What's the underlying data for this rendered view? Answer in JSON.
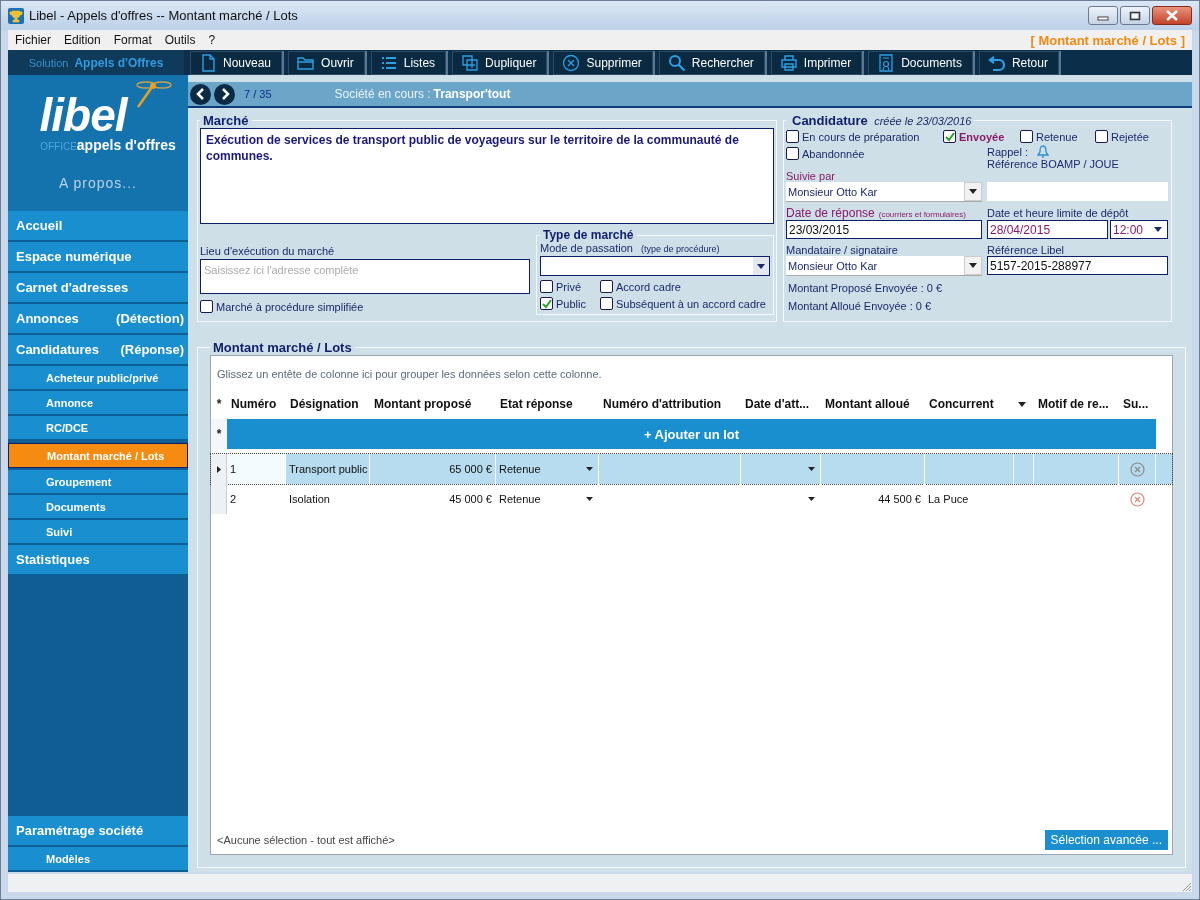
{
  "window": {
    "title": "Libel - Appels d'offres -- Montant marché / Lots",
    "section_tag": "[ Montant marché / Lots ]"
  },
  "menu": [
    "Fichier",
    "Edition",
    "Format",
    "Outils",
    "?"
  ],
  "toolbar": {
    "solution_label": "Solution",
    "solution_name": "Appels d'Offres",
    "buttons": [
      {
        "label": "Nouveau",
        "kind": "new"
      },
      {
        "label": "Ouvrir",
        "kind": "open"
      },
      {
        "label": "Listes",
        "kind": "list"
      },
      {
        "label": "Dupliquer",
        "kind": "duplicate"
      },
      {
        "label": "Supprimer",
        "kind": "delete"
      },
      {
        "label": "Rechercher",
        "kind": "search"
      },
      {
        "label": "Imprimer",
        "kind": "print"
      },
      {
        "label": "Documents",
        "kind": "document"
      },
      {
        "label": "Retour",
        "kind": "back"
      }
    ]
  },
  "sidebar": {
    "brand": "libel",
    "brand_office": "OFFICE",
    "brand_tagline": "appels d'offres",
    "about": "A propos...",
    "items": [
      {
        "label": "Accueil",
        "kind": "main",
        "selected": false
      },
      {
        "label": "Espace numérique",
        "kind": "main",
        "selected": false
      },
      {
        "label": "Carnet d'adresses",
        "kind": "main",
        "selected": false
      },
      {
        "label": "Annonces",
        "note": "(Détection)",
        "kind": "main",
        "selected": false
      },
      {
        "label": "Candidatures",
        "note": "(Réponse)",
        "kind": "main",
        "selected": false
      },
      {
        "label": "Acheteur public/privé",
        "kind": "sub",
        "selected": false
      },
      {
        "label": "Annonce",
        "kind": "sub",
        "selected": false
      },
      {
        "label": "RC/DCE",
        "kind": "sub",
        "selected": false
      },
      {
        "label": "Montant marché / Lots",
        "kind": "sub",
        "selected": true
      },
      {
        "label": "Groupement",
        "kind": "sub",
        "selected": false
      },
      {
        "label": "Documents",
        "kind": "sub",
        "selected": false
      },
      {
        "label": "Suivi",
        "kind": "sub",
        "selected": false
      },
      {
        "label": "Statistiques",
        "kind": "main",
        "selected": false
      }
    ],
    "bottom_items": [
      {
        "label": "Paramétrage société",
        "kind": "main",
        "selected": false
      },
      {
        "label": "Modèles",
        "kind": "sub",
        "selected": false
      }
    ]
  },
  "record_nav": {
    "position": "7 / 35",
    "company_label": "Société en cours :",
    "company": "Transpor'tout"
  },
  "marche": {
    "title": "Marché",
    "description": "Exécution de services de transport public de voyageurs sur le territoire de la communauté de communes.",
    "lieu_label": "Lieu d'exécution du marché",
    "lieu_placeholder": "Saisissez ici l'adresse complète",
    "simplified": {
      "label": "Marché à procédure simplifiée",
      "checked": false
    },
    "type_title": "Type de marché",
    "mode_label": "Mode de passation",
    "mode_hint": "(type de procédure)",
    "type_options": [
      {
        "label": "Privé",
        "checked": false
      },
      {
        "label": "Accord cadre",
        "checked": false
      },
      {
        "label": "Public",
        "checked": true
      },
      {
        "label": "Subséquent à un accord cadre",
        "checked": false
      }
    ]
  },
  "candidature": {
    "title": "Candidature",
    "created": "créée le 23/03/2016",
    "statuses": [
      {
        "label": "En cours de préparation",
        "checked": false
      },
      {
        "label": "Envoyée",
        "checked": true
      },
      {
        "label": "Retenue",
        "checked": false
      },
      {
        "label": "Rejetée",
        "checked": false
      },
      {
        "label": "Abandonnée",
        "checked": false
      }
    ],
    "rappel_label": "Rappel :",
    "ref_boamp_label": "Référence BOAMP / JOUE",
    "suivie_label": "Suivie par",
    "suivie_value": "Monsieur Otto Kar",
    "date_reponse_label": "Date de réponse",
    "date_reponse_hint": "(courriers et formulaires)",
    "date_reponse": "23/03/2015",
    "limite_label": "Date et heure limite de dépôt",
    "limite_date": "28/04/2015",
    "limite_time": "12:00",
    "mandataire_label": "Mandataire / signataire",
    "mandataire_value": "Monsieur Otto Kar",
    "ref_libel_label": "Référence Libel",
    "ref_libel": "5157-2015-288977",
    "montant_propose": "Montant Proposé Envoyée : 0 €",
    "montant_alloue": "Montant Alloué Envoyée : 0 €"
  },
  "lots": {
    "title": "Montant marché / Lots",
    "group_hint": "Glissez un entête de colonne ici pour grouper les données selon cette colonne.",
    "columns": [
      "Numéro",
      "Désignation",
      "Montant proposé",
      "Etat réponse",
      "Numéro d'attribution",
      "Date d'att...",
      "Montant alloué",
      "Concurrent",
      "Motif de re...",
      "Su..."
    ],
    "header_marker": "*",
    "add_row_marker": "*",
    "add_row": "+ Ajouter un lot",
    "rows": [
      {
        "numero": "1",
        "designation": "Transport public",
        "montant_propose": "65 000 €",
        "etat": "Retenue",
        "selected": true
      },
      {
        "numero": "2",
        "designation": "Isolation",
        "montant_propose": "45 000 €",
        "etat": "Retenue",
        "montant_alloue": "44 500 €",
        "concurrent": "La Puce",
        "selected": false
      }
    ],
    "footer": "<Aucune sélection - tout est affiché>",
    "advanced_button": "Sélection avancée ..."
  }
}
